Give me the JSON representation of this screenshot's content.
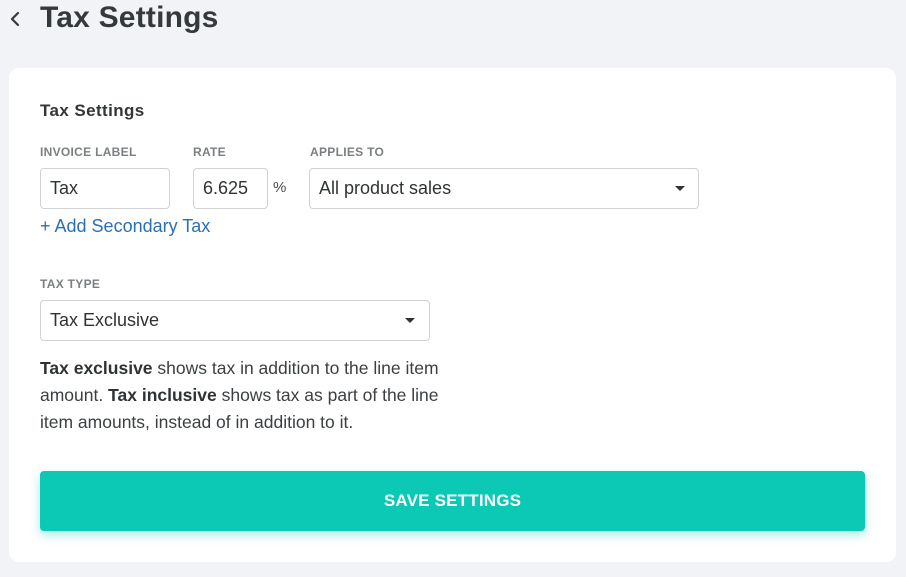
{
  "header": {
    "back_icon": "chevron-left-icon",
    "title": "Tax Settings"
  },
  "card": {
    "title": "Tax Settings",
    "invoice_label": {
      "label": "INVOICE LABEL",
      "value": "Tax"
    },
    "rate": {
      "label": "RATE",
      "value": "6.625",
      "unit": "%"
    },
    "applies_to": {
      "label": "APPLIES TO",
      "selected": "All product sales"
    },
    "add_secondary_tax": "+ Add Secondary Tax",
    "tax_type": {
      "label": "TAX TYPE",
      "selected": "Tax Exclusive"
    },
    "help": {
      "exclusive_term": "Tax exclusive",
      "exclusive_desc": " shows tax in addition to the line item amount. ",
      "inclusive_term": "Tax inclusive",
      "inclusive_desc": " shows tax as part of the line item amounts, instead of in addition to it."
    },
    "save_label": "SAVE SETTINGS"
  },
  "colors": {
    "background": "#f2f3f6",
    "card": "#ffffff",
    "accent": "#0cc9b6",
    "link": "#2a6fb8",
    "border": "#cfd2d6"
  }
}
